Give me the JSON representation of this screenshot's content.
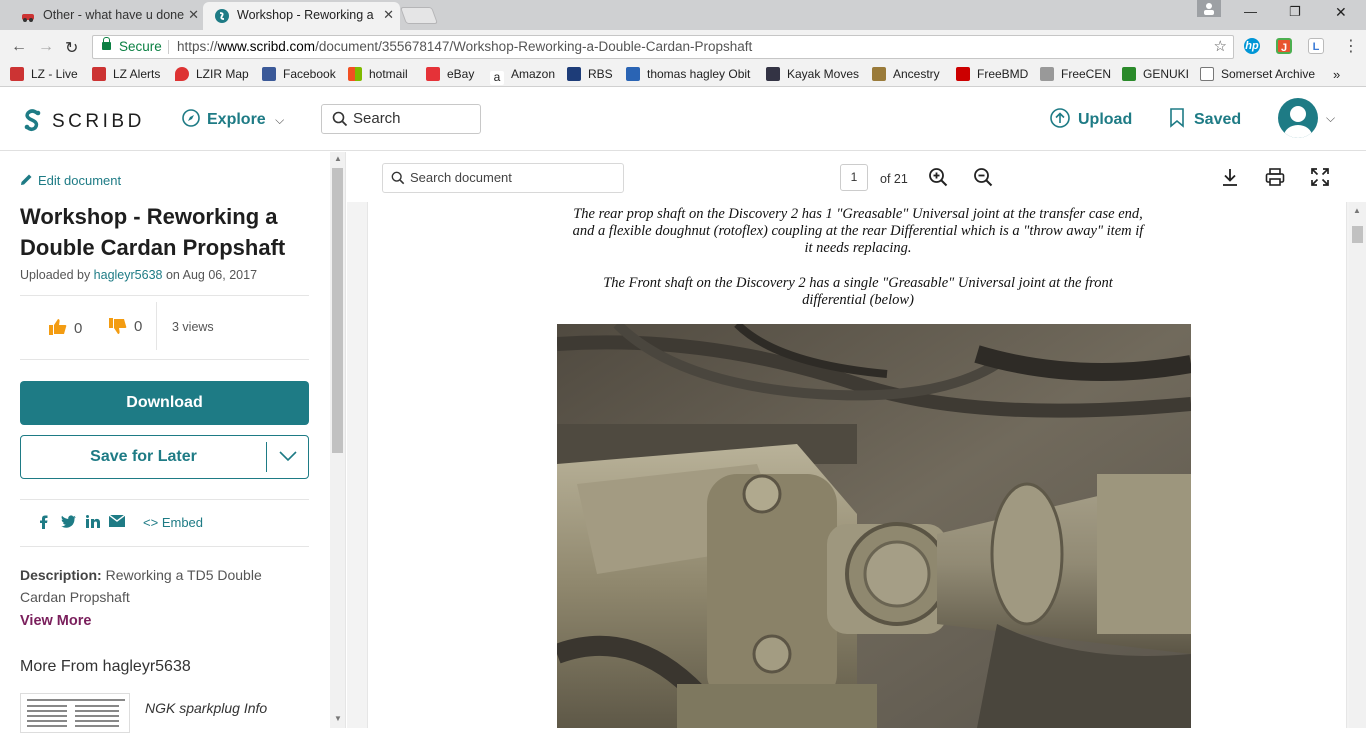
{
  "browser": {
    "tabs": [
      {
        "label": "Other - what have u done"
      },
      {
        "label": "Workshop - Reworking a"
      }
    ],
    "address": {
      "secure_label": "Secure",
      "url_prefix": "https://",
      "url_host": "www.scribd.com",
      "url_path": "/document/355678147/Workshop-Reworking-a-Double-Cardan-Propshaft"
    },
    "bookmarks": [
      {
        "label": "LZ - Live",
        "color": "#c33"
      },
      {
        "label": "LZ Alerts",
        "color": "#c33"
      },
      {
        "label": "LZIR Map",
        "color": "#d33"
      },
      {
        "label": "Facebook",
        "color": "#3b5998"
      },
      {
        "label": "hotmail",
        "color": "#f25022"
      },
      {
        "label": "eBay",
        "color": "#e53238"
      },
      {
        "label": "Amazon",
        "color": "#222"
      },
      {
        "label": "RBS",
        "color": "#1d3c78"
      },
      {
        "label": "thomas hagley Obit",
        "color": "#2a64b4"
      },
      {
        "label": "Kayak Moves",
        "color": "#334"
      },
      {
        "label": "Ancestry",
        "color": "#9a7b3a"
      },
      {
        "label": "FreeBMD",
        "color": "#c00"
      },
      {
        "label": "FreeCEN",
        "color": "#999"
      },
      {
        "label": "GENUKI",
        "color": "#2a8a2a"
      },
      {
        "label": "Somerset Archive",
        "color": "#ffffff"
      }
    ],
    "bookmarks_more": "»"
  },
  "header": {
    "logo": "SCRIBD",
    "explore": "Explore",
    "search_placeholder": "Search",
    "upload": "Upload",
    "saved": "Saved"
  },
  "sidebar": {
    "edit": "Edit document",
    "title": "Workshop - Reworking a Double Cardan Propshaft",
    "uploaded_by_prefix": "Uploaded by ",
    "uploader": "hagleyr5638",
    "uploaded_on": " on Aug 06, 2017",
    "upvotes": "0",
    "downvotes": "0",
    "views": "3 views",
    "download": "Download",
    "save_for_later": "Save for Later",
    "embed": "Embed",
    "description_label": "Description:",
    "description": " Reworking a TD5 Double Cardan Propshaft",
    "view_more": "View More",
    "more_from": "More From hagleyr5638",
    "more_doc_title": "NGK sparkplug Info"
  },
  "viewer": {
    "search_placeholder": "Search document",
    "page_current": "1",
    "page_of": "of 21",
    "paragraph1_line1": "The rear prop shaft on the Discovery 2 has 1 \"Greasable\" Universal joint at the transfer case end,",
    "paragraph1_line2": "and a flexible doughnut (rotoflex) coupling at the rear Differential which is a \"throw away\" item if",
    "paragraph1_line3": "it needs replacing.",
    "paragraph2_line1": "The Front shaft on the Discovery 2 has a single \"Greasable\" Universal joint at the front",
    "paragraph2_line2": "differential (below)"
  },
  "colors": {
    "accent": "#1e7b85",
    "view_more": "#7a1f5c",
    "thumb_icon": "#f39c12"
  }
}
